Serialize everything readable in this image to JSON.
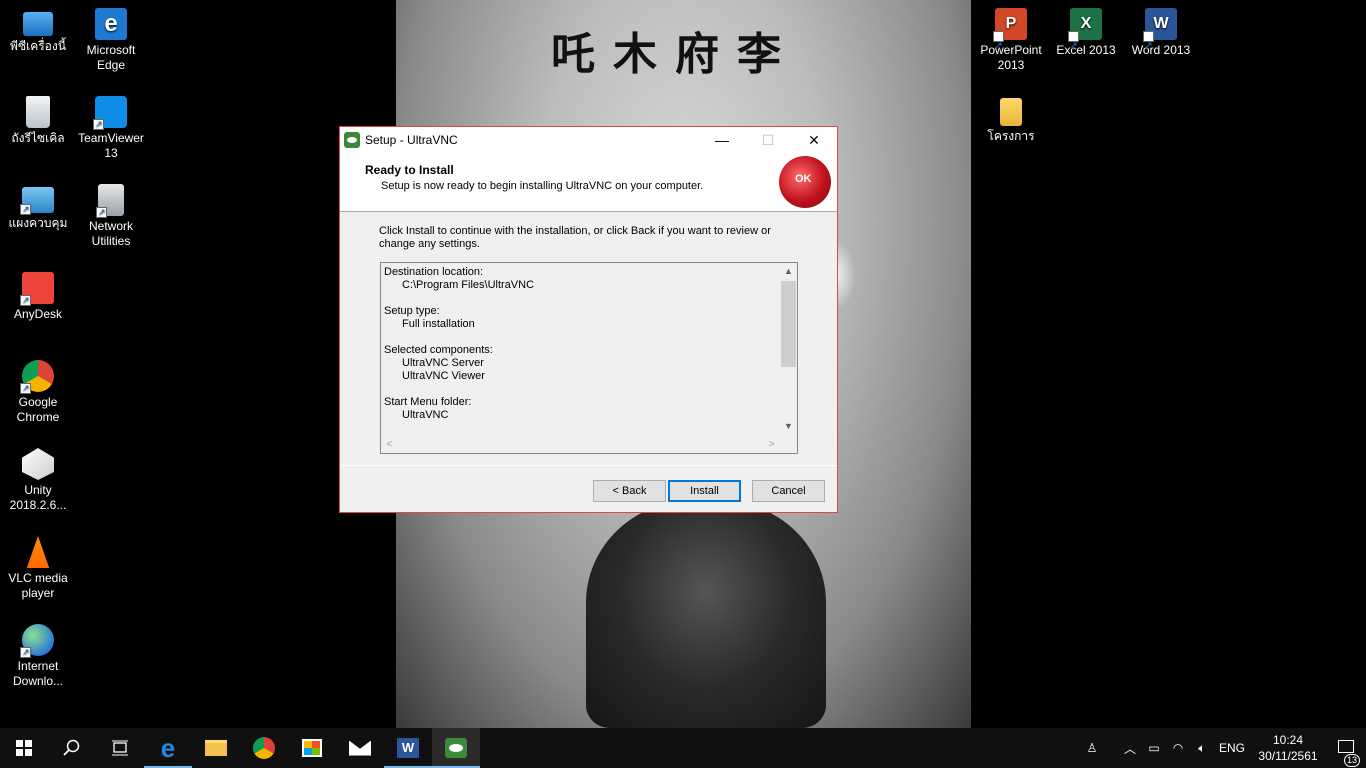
{
  "desktop_icons": {
    "this_pc": "พีซีเครื่องนี้",
    "edge": "Microsoft Edge",
    "recycle_bin": "ถังรีไซเคิล",
    "teamviewer": "TeamViewer 13",
    "control_panel": "แผงควบคุม",
    "network_utilities": "Network Utilities",
    "anydesk": "AnyDesk",
    "chrome": "Google Chrome",
    "unity": "Unity 2018.2.6...",
    "vlc": "VLC media player",
    "idm": "Internet Downlo...",
    "powerpoint": "PowerPoint 2013",
    "excel": "Excel 2013",
    "word": "Word 2013",
    "project_folder": "โครงการ"
  },
  "dialog": {
    "title": "Setup - UltraVNC",
    "header_title": "Ready to Install",
    "header_subtitle": "Setup is now ready to begin installing UltraVNC on your computer.",
    "instruction": "Click Install to continue with the installation, or click Back if you want to review or change any settings.",
    "summary": {
      "dest_label": "Destination location:",
      "dest_value": "C:\\Program Files\\UltraVNC",
      "type_label": "Setup type:",
      "type_value": "Full installation",
      "components_label": "Selected components:",
      "component_1": "UltraVNC Server",
      "component_2": "UltraVNC Viewer",
      "menu_label": "Start Menu folder:",
      "menu_value": "UltraVNC"
    },
    "back_label": "< Back",
    "install_label": "Install",
    "cancel_label": "Cancel",
    "minimize_glyph": "—",
    "maximize_glyph": "☐",
    "close_glyph": "✕"
  },
  "wallpaper_text": "吒木府李",
  "taskbar": {
    "language": "ENG",
    "time": "10:24",
    "date": "30/11/2561",
    "notification_count": "13"
  },
  "colors": {
    "dialog_border": "#e0484b",
    "accent": "#0078d7",
    "taskbar": "#101010"
  }
}
